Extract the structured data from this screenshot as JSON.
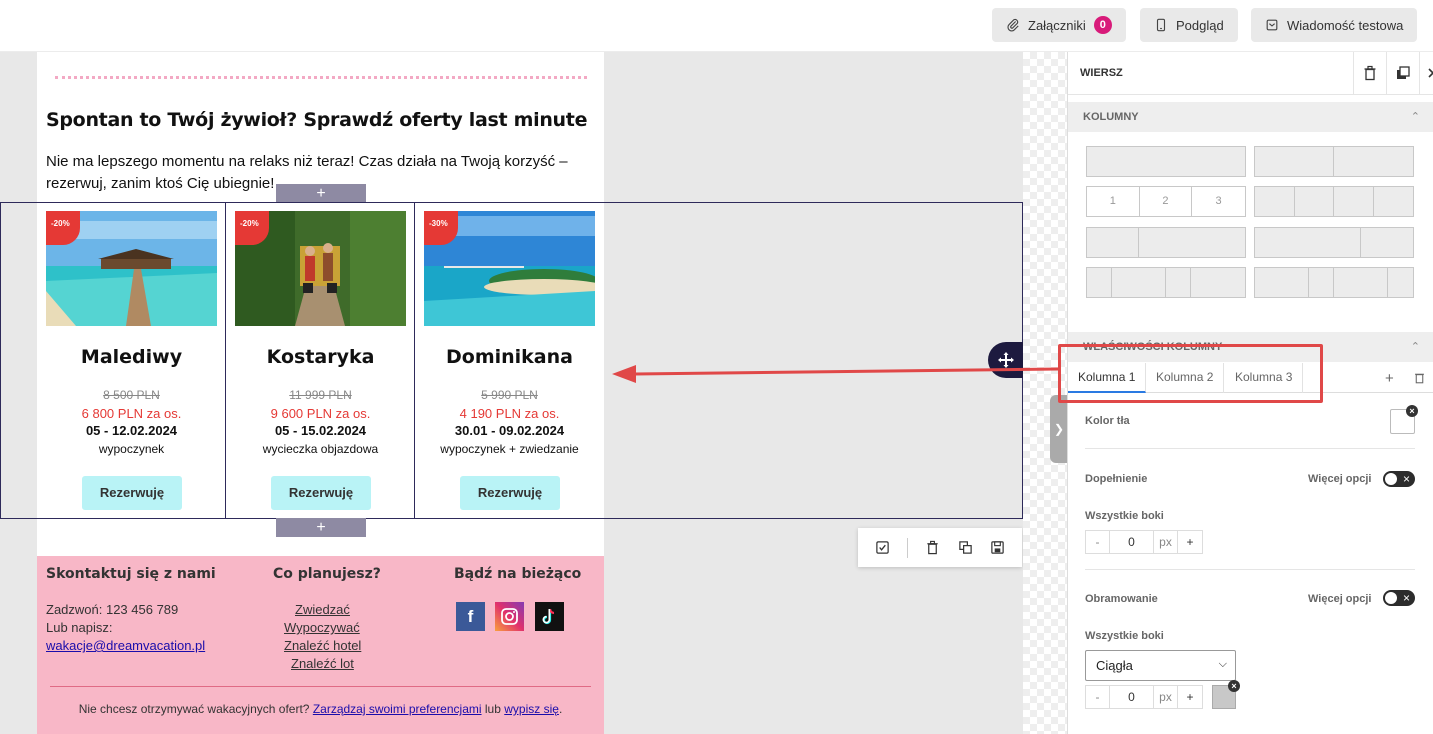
{
  "toolbar": {
    "attachments_label": "Załączniki",
    "attachments_count": "0",
    "preview_label": "Podgląd",
    "test_message_label": "Wiadomość testowa"
  },
  "email": {
    "headline": "Spontan to Twój żywioł? Sprawdź oferty last minute",
    "intro": "Nie ma lepszego momentu na relaks niż teraz! Czas działa na Twoją korzyść – rezerwuj, zanim ktoś Cię ubiegnie!",
    "add_symbol": "+",
    "cards": [
      {
        "discount": "-20%",
        "title": "Malediwy",
        "old_price": "8 500 PLN",
        "new_price": "6 800 PLN za os.",
        "dates": "05 - 12.02.2024",
        "type": "wypoczynek",
        "button": "Rezerwuję"
      },
      {
        "discount": "-20%",
        "title": "Kostaryka",
        "old_price": "11 999 PLN",
        "new_price": "9 600 PLN za os.",
        "dates": "05 - 15.02.2024",
        "type": "wycieczka objazdowa",
        "button": "Rezerwuję"
      },
      {
        "discount": "-30%",
        "title": "Dominikana",
        "old_price": "5 990 PLN",
        "new_price": "4 190 PLN za os.",
        "dates": "30.01 - 09.02.2024",
        "type": "wypoczynek + zwiedzanie",
        "button": "Rezerwuję"
      }
    ],
    "footer": {
      "contact_heading": "Skontaktuj się z nami",
      "phone": "Zadzwoń: 123 456 789",
      "write": "Lub napisz:",
      "email": "wakacje@dreamvacation.pl",
      "plans_heading": "Co planujesz?",
      "plans": [
        "Zwiedzać",
        "Wypoczywać",
        "Znaleźć hotel",
        "Znaleźć lot"
      ],
      "social_heading": "Bądź na bieżąco",
      "unsubscribe_text": "Nie chcesz otrzymywać wakacyjnych ofert?",
      "manage_link": "Zarządzaj swoimi preferencjami",
      "or": "lub",
      "unsubscribe_link": "wypisz się",
      "period": "."
    }
  },
  "panel": {
    "title": "WIERSZ",
    "columns_section": "KOLUMNY",
    "layout_numbers": [
      "1",
      "2",
      "3"
    ],
    "column_props_section": "WŁAŚCIWOŚCI KOLUMNY",
    "tabs": [
      "Kolumna 1",
      "Kolumna 2",
      "Kolumna 3"
    ],
    "bg_color_label": "Kolor tła",
    "padding_label": "Dopełnienie",
    "more_options": "Więcej opcji",
    "all_sides": "Wszystkie boki",
    "padding_value": "0",
    "unit": "px",
    "minus": "-",
    "plus": "+",
    "border_label": "Obramowanie",
    "border_style": "Ciągła",
    "border_value": "0"
  },
  "colors": {
    "accent_pink": "#f8b7c7",
    "discount_red": "#e53935",
    "button_cyan": "#b9f3f6",
    "annotation_red": "#e04848",
    "badge_magenta": "#d81b7a"
  }
}
